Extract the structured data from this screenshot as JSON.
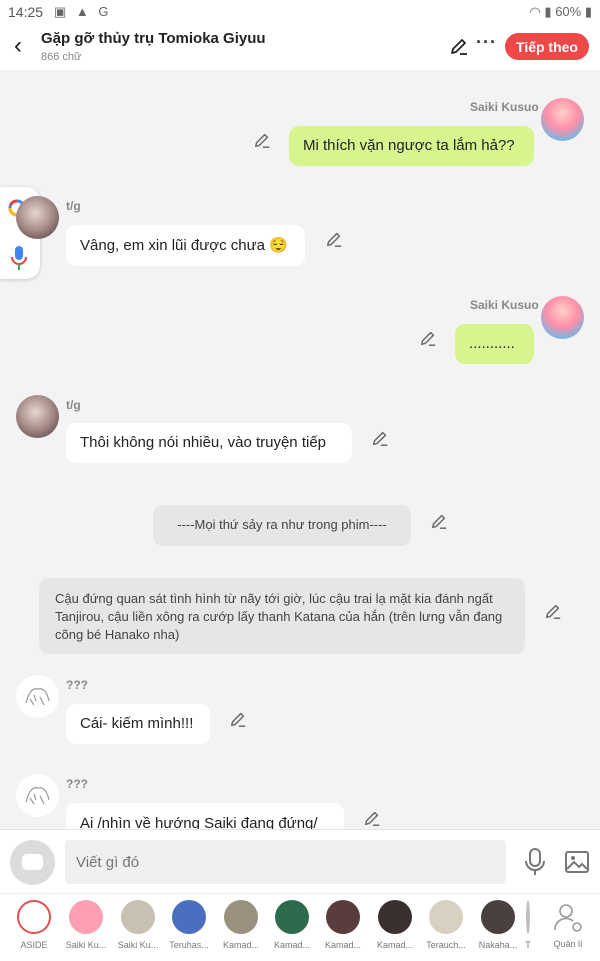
{
  "status_bar": {
    "time": "14:25",
    "battery": "60%"
  },
  "header": {
    "title": "Gặp gỡ thủy trụ Tomioka Giyuu",
    "word_count": "866 chữ",
    "next_label": "Tiếp theo"
  },
  "messages": [
    {
      "sender": "Saiki Kusuo",
      "text": "Mi thích vặn ngược ta lắm hả??"
    },
    {
      "sender": "t/g",
      "text": "Vâng, em xin lũi được chưa 😌"
    },
    {
      "sender": "Saiki Kusuo",
      "text": "..........."
    },
    {
      "sender": "t/g",
      "text": "Thôi không nói nhiều, vào truyện tiếp"
    },
    {
      "text": "----Mọi thứ sảy ra như trong phim----"
    },
    {
      "text": "Cậu đứng quan sát tình hình từ nãy tới giờ, lúc cậu trai lạ mặt kia đánh ngất Tanjirou, cậu liền xông ra cướp lấy thanh Katana của hắn (trên lưng vẫn đang cõng bé Hanako nha)"
    },
    {
      "sender": "???",
      "text": "Cái- kiếm mình!!!"
    },
    {
      "sender": "???",
      "text": "Ai /nhìn về hướng Saiki đang đứng/"
    }
  ],
  "input": {
    "placeholder": "Viết gì đó"
  },
  "characters": [
    {
      "label": "ASIDE",
      "color": "#e05050"
    },
    {
      "label": "Saiki Ku...",
      "color": "#ff9fb4"
    },
    {
      "label": "Saiki Ku...",
      "color": "#c8c0b0"
    },
    {
      "label": "Teruhas...",
      "color": "#4a6ec0"
    },
    {
      "label": "Kamad...",
      "color": "#9a9080"
    },
    {
      "label": "Kamad...",
      "color": "#2e6a4e"
    },
    {
      "label": "Kamad...",
      "color": "#5a3c3c"
    },
    {
      "label": "Kamad...",
      "color": "#3a3030"
    },
    {
      "label": "Terauch...",
      "color": "#d8d0c0"
    },
    {
      "label": "Nakaha...",
      "color": "#4a4040"
    },
    {
      "label": "T",
      "color": "#c0c0c0"
    },
    {
      "label": "Quản lí",
      "color": "#999999"
    }
  ]
}
